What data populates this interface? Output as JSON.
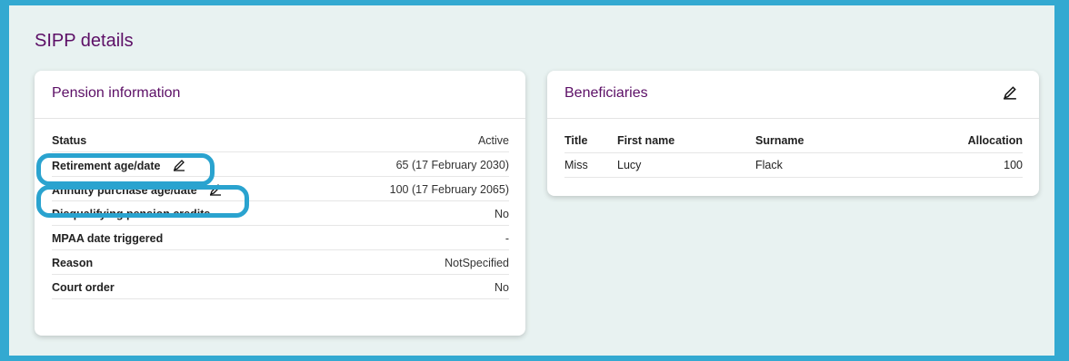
{
  "page_title": "SIPP details",
  "pension": {
    "title": "Pension information",
    "rows": [
      {
        "label": "Status",
        "value": "Active"
      },
      {
        "label": "Retirement age/date",
        "value": "65 (17 February 2030)"
      },
      {
        "label": "Annuity purchase age/date",
        "value": "100 (17 February 2065)"
      },
      {
        "label": "Disqualifying pension credits",
        "value": "No"
      },
      {
        "label": "MPAA date triggered",
        "value": "-"
      },
      {
        "label": "Reason",
        "value": "NotSpecified"
      },
      {
        "label": "Court order",
        "value": "No"
      }
    ]
  },
  "beneficiaries": {
    "title": "Beneficiaries",
    "columns": [
      "Title",
      "First name",
      "Surname",
      "Allocation"
    ],
    "rows": [
      {
        "title": "Miss",
        "first_name": "Lucy",
        "surname": "Flack",
        "allocation": "100"
      }
    ]
  },
  "colors": {
    "accent": "#5c0f66",
    "highlight": "#2aa3cf",
    "background": "#e8f2f1",
    "frame": "#33a9d1"
  },
  "icons": {
    "edit": "pencil-icon"
  }
}
